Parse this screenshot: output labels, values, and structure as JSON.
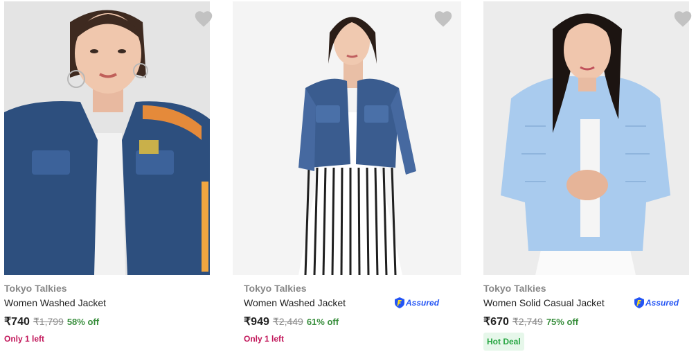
{
  "products": [
    {
      "brand": "Tokyo Talkies",
      "title": "Women Washed Jacket",
      "price": "₹740",
      "mrp": "₹1,799",
      "discount": "58% off",
      "stock": "Only 1 left",
      "assured": false,
      "image": "woman-denim-jacket-white-top"
    },
    {
      "brand": "Tokyo Talkies",
      "title": "Women Washed Jacket",
      "price": "₹949",
      "mrp": "₹2,449",
      "discount": "61% off",
      "stock": "Only 1 left",
      "assured": true,
      "assured_label": "Assured",
      "image": "woman-cropped-denim-jacket-striped-dress"
    },
    {
      "brand": "Tokyo Talkies",
      "title": "Women Solid Casual Jacket",
      "price": "₹670",
      "mrp": "₹2,749",
      "discount": "75% off",
      "deal": "Hot Deal",
      "assured": true,
      "assured_label": "Assured",
      "image": "woman-light-blue-puffer-jacket"
    }
  ],
  "icons": {
    "wishlist": "heart-icon",
    "assured": "flipkart-assured-badge-icon"
  },
  "colors": {
    "discount": "#388e3c",
    "stock_warning": "#c2185b",
    "deal_text": "#26a541",
    "deal_bg": "#e6f7ea",
    "assured": "#2455f4",
    "wishlist": "#c2c2c2"
  }
}
